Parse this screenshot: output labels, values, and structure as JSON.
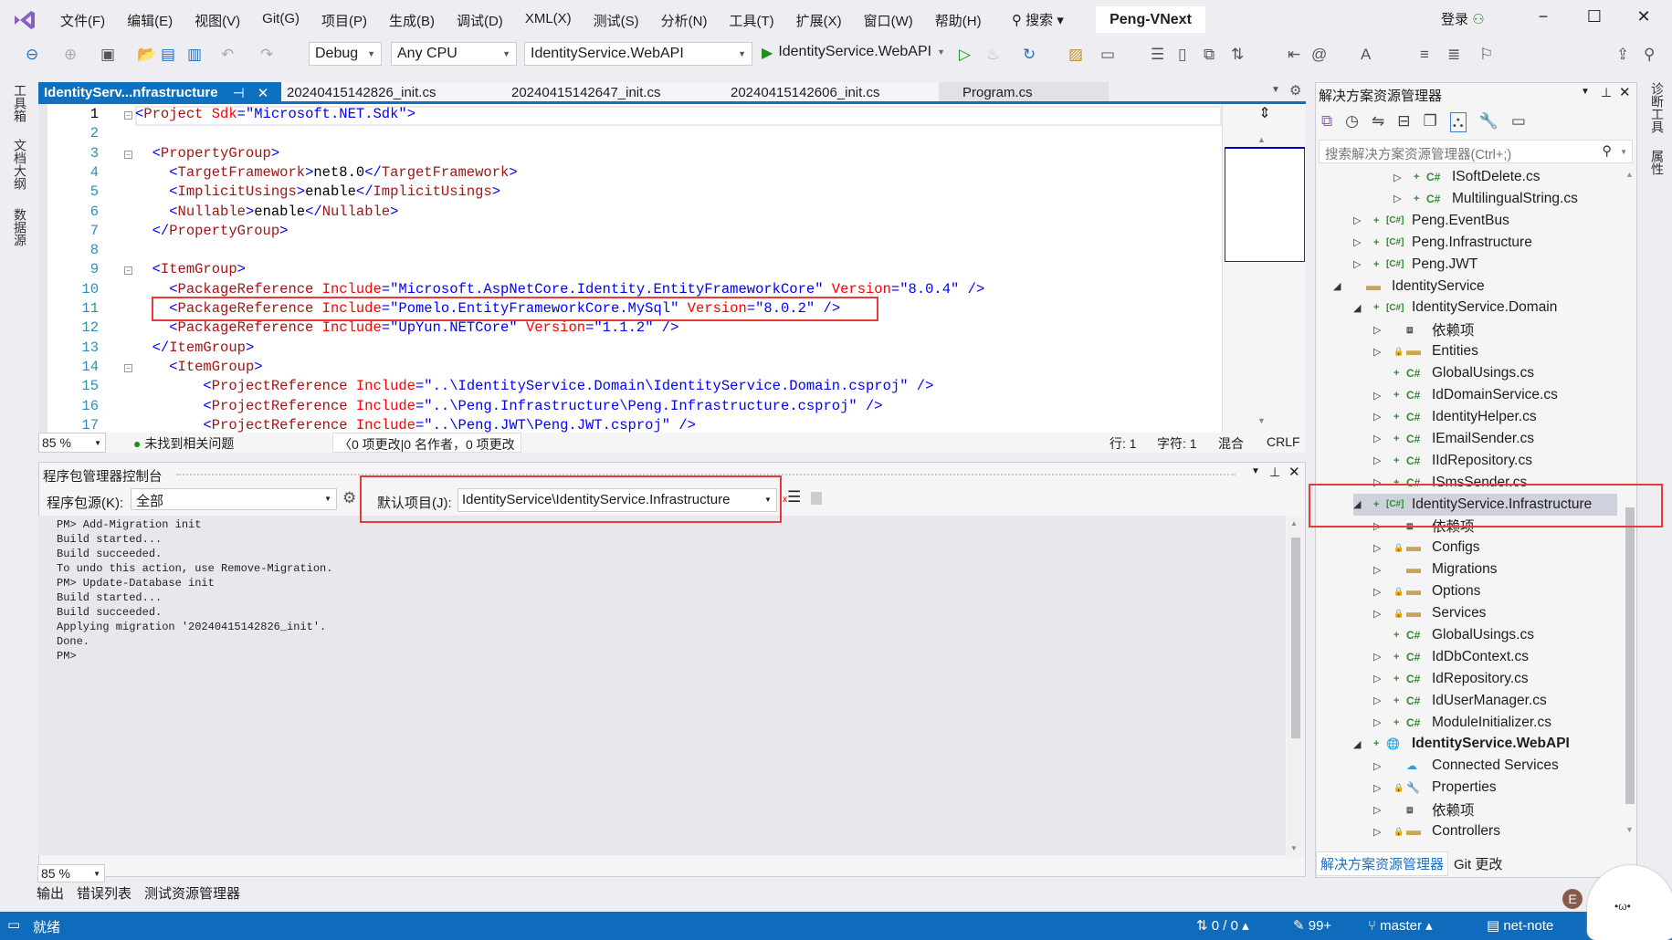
{
  "title_bar": {
    "menus": [
      "文件(F)",
      "编辑(E)",
      "视图(V)",
      "Git(G)",
      "项目(P)",
      "生成(B)",
      "调试(D)",
      "XML(X)",
      "测试(S)",
      "分析(N)",
      "工具(T)",
      "扩展(X)",
      "窗口(W)",
      "帮助(H)"
    ],
    "search": "搜索",
    "solution_name": "Peng-VNext",
    "login": "登录"
  },
  "toolbar": {
    "configuration": "Debug",
    "platform": "Any CPU",
    "startup_project": "IdentityService.WebAPI",
    "run_target": "IdentityService.WebAPI"
  },
  "left_strip": [
    "工具箱",
    "文档大纲",
    "数据源"
  ],
  "right_strip": [
    "诊断工具",
    "属性"
  ],
  "tabs": [
    {
      "label": "IdentityServ...nfrastructure",
      "active": true
    },
    {
      "label": "20240415142826_init.cs"
    },
    {
      "label": "20240415142647_init.cs"
    },
    {
      "label": "20240415142606_init.cs"
    },
    {
      "label": "Program.cs"
    }
  ],
  "editor": {
    "lines": [
      [
        [
          "p",
          "<"
        ],
        [
          "tag",
          "Project"
        ],
        [
          "txt",
          " "
        ],
        [
          "attr",
          "Sdk"
        ],
        [
          "p",
          "=\""
        ],
        [
          "val",
          "Microsoft.NET.Sdk"
        ],
        [
          "p",
          "\">"
        ]
      ],
      [],
      [
        [
          "txt",
          "  "
        ],
        [
          "p",
          "<"
        ],
        [
          "tag",
          "PropertyGroup"
        ],
        [
          "p",
          ">"
        ]
      ],
      [
        [
          "txt",
          "    "
        ],
        [
          "p",
          "<"
        ],
        [
          "tag",
          "TargetFramework"
        ],
        [
          "p",
          ">"
        ],
        [
          "txt",
          "net8.0"
        ],
        [
          "p",
          "</"
        ],
        [
          "tag",
          "TargetFramework"
        ],
        [
          "p",
          ">"
        ]
      ],
      [
        [
          "txt",
          "    "
        ],
        [
          "p",
          "<"
        ],
        [
          "tag",
          "ImplicitUsings"
        ],
        [
          "p",
          ">"
        ],
        [
          "txt",
          "enable"
        ],
        [
          "p",
          "</"
        ],
        [
          "tag",
          "ImplicitUsings"
        ],
        [
          "p",
          ">"
        ]
      ],
      [
        [
          "txt",
          "    "
        ],
        [
          "p",
          "<"
        ],
        [
          "tag",
          "Nullable"
        ],
        [
          "p",
          ">"
        ],
        [
          "txt",
          "enable"
        ],
        [
          "p",
          "</"
        ],
        [
          "tag",
          "Nullable"
        ],
        [
          "p",
          ">"
        ]
      ],
      [
        [
          "txt",
          "  "
        ],
        [
          "p",
          "</"
        ],
        [
          "tag",
          "PropertyGroup"
        ],
        [
          "p",
          ">"
        ]
      ],
      [],
      [
        [
          "txt",
          "  "
        ],
        [
          "p",
          "<"
        ],
        [
          "tag",
          "ItemGroup"
        ],
        [
          "p",
          ">"
        ]
      ],
      [
        [
          "txt",
          "    "
        ],
        [
          "p",
          "<"
        ],
        [
          "tag",
          "PackageReference"
        ],
        [
          "txt",
          " "
        ],
        [
          "attr",
          "Include"
        ],
        [
          "p",
          "=\""
        ],
        [
          "val",
          "Microsoft.AspNetCore.Identity.EntityFrameworkCore"
        ],
        [
          "p",
          "\" "
        ],
        [
          "attr",
          "Version"
        ],
        [
          "p",
          "=\""
        ],
        [
          "val",
          "8.0.4"
        ],
        [
          "p",
          "\" />"
        ]
      ],
      [
        [
          "txt",
          "    "
        ],
        [
          "p",
          "<"
        ],
        [
          "tag",
          "PackageReference"
        ],
        [
          "txt",
          " "
        ],
        [
          "attr",
          "Include"
        ],
        [
          "p",
          "=\""
        ],
        [
          "val",
          "Pomelo.EntityFrameworkCore.MySql"
        ],
        [
          "p",
          "\" "
        ],
        [
          "attr",
          "Version"
        ],
        [
          "p",
          "=\""
        ],
        [
          "val",
          "8.0.2"
        ],
        [
          "p",
          "\" />"
        ]
      ],
      [
        [
          "txt",
          "    "
        ],
        [
          "p",
          "<"
        ],
        [
          "tag",
          "PackageReference"
        ],
        [
          "txt",
          " "
        ],
        [
          "attr",
          "Include"
        ],
        [
          "p",
          "=\""
        ],
        [
          "val",
          "UpYun.NETCore"
        ],
        [
          "p",
          "\" "
        ],
        [
          "attr",
          "Version"
        ],
        [
          "p",
          "=\""
        ],
        [
          "val",
          "1.1.2"
        ],
        [
          "p",
          "\" />"
        ]
      ],
      [
        [
          "txt",
          "  "
        ],
        [
          "p",
          "</"
        ],
        [
          "tag",
          "ItemGroup"
        ],
        [
          "p",
          ">"
        ]
      ],
      [
        [
          "txt",
          "    "
        ],
        [
          "p",
          "<"
        ],
        [
          "tag",
          "ItemGroup"
        ],
        [
          "p",
          ">"
        ]
      ],
      [
        [
          "txt",
          "        "
        ],
        [
          "p",
          "<"
        ],
        [
          "tag",
          "ProjectReference"
        ],
        [
          "txt",
          " "
        ],
        [
          "attr",
          "Include"
        ],
        [
          "p",
          "=\""
        ],
        [
          "val",
          "..\\IdentityService.Domain\\IdentityService.Domain.csproj"
        ],
        [
          "p",
          "\" />"
        ]
      ],
      [
        [
          "txt",
          "        "
        ],
        [
          "p",
          "<"
        ],
        [
          "tag",
          "ProjectReference"
        ],
        [
          "txt",
          " "
        ],
        [
          "attr",
          "Include"
        ],
        [
          "p",
          "=\""
        ],
        [
          "val",
          "..\\Peng.Infrastructure\\Peng.Infrastructure.csproj"
        ],
        [
          "p",
          "\" />"
        ]
      ],
      [
        [
          "txt",
          "        "
        ],
        [
          "p",
          "<"
        ],
        [
          "tag",
          "ProjectReference"
        ],
        [
          "txt",
          " "
        ],
        [
          "attr",
          "Include"
        ],
        [
          "p",
          "=\""
        ],
        [
          "val",
          "..\\Peng.JWT\\Peng.JWT.csproj"
        ],
        [
          "p",
          "\" />"
        ]
      ]
    ],
    "zoom": "85 %",
    "issues": "未找到相关问题",
    "changes": "0 项更改|0 名作者，0 项更改",
    "row": "行: 1",
    "col": "字符: 1",
    "whitespace": "混合",
    "eol": "CRLF"
  },
  "pmc": {
    "title": "程序包管理器控制台",
    "source_label": "程序包源(K):",
    "source_value": "全部",
    "default_project_label": "默认项目(J):",
    "default_project_value": "IdentityService\\IdentityService.Infrastructure",
    "output": [
      "PM> Add-Migration init",
      "Build started...",
      "Build succeeded.",
      "To undo this action, use Remove-Migration.",
      "PM> Update-Database init",
      "Build started...",
      "Build succeeded.",
      "Applying migration '20240415142826_init'.",
      "Done.",
      "PM>"
    ],
    "zoom": "85 %"
  },
  "bottom_tabs": [
    "输出",
    "错误列表",
    "测试资源管理器"
  ],
  "solution_explorer": {
    "title": "解决方案资源管理器",
    "search_placeholder": "搜索解决方案资源管理器(Ctrl+;)",
    "items": [
      {
        "label": "ISoftDelete.cs",
        "level": 3,
        "exp": "closed",
        "ov": "plus",
        "icon": "cs"
      },
      {
        "label": "MultilingualString.cs",
        "level": 3,
        "exp": "closed",
        "ov": "plus",
        "icon": "cs"
      },
      {
        "label": "Peng.EventBus",
        "level": 1,
        "exp": "closed",
        "ov": "plus",
        "icon": "csproj"
      },
      {
        "label": "Peng.Infrastructure",
        "level": 1,
        "exp": "closed",
        "ov": "plus",
        "icon": "csproj"
      },
      {
        "label": "Peng.JWT",
        "level": 1,
        "exp": "closed",
        "ov": "plus",
        "icon": "csproj"
      },
      {
        "label": "IdentityService",
        "level": 0,
        "exp": "open",
        "ov": "",
        "icon": "folder"
      },
      {
        "label": "IdentityService.Domain",
        "level": 1,
        "exp": "open",
        "ov": "plus",
        "icon": "csproj"
      },
      {
        "label": "依赖项",
        "level": 2,
        "exp": "closed",
        "ov": "",
        "icon": "deps"
      },
      {
        "label": "Entities",
        "level": 2,
        "exp": "closed",
        "ov": "lock",
        "icon": "folder"
      },
      {
        "label": "GlobalUsings.cs",
        "level": 2,
        "exp": "",
        "ov": "plus",
        "icon": "cs"
      },
      {
        "label": "IdDomainService.cs",
        "level": 2,
        "exp": "closed",
        "ov": "plus",
        "icon": "cs"
      },
      {
        "label": "IdentityHelper.cs",
        "level": 2,
        "exp": "closed",
        "ov": "plus",
        "icon": "cs"
      },
      {
        "label": "IEmailSender.cs",
        "level": 2,
        "exp": "closed",
        "ov": "plus",
        "icon": "cs"
      },
      {
        "label": "IIdRepository.cs",
        "level": 2,
        "exp": "closed",
        "ov": "plus",
        "icon": "cs"
      },
      {
        "label": "ISmsSender.cs",
        "level": 2,
        "exp": "closed",
        "ov": "plus",
        "icon": "cs"
      },
      {
        "label": "IdentityService.Infrastructure",
        "level": 1,
        "exp": "open",
        "ov": "plus",
        "icon": "csproj",
        "selected": true
      },
      {
        "label": "依赖项",
        "level": 2,
        "exp": "closed",
        "ov": "",
        "icon": "deps"
      },
      {
        "label": "Configs",
        "level": 2,
        "exp": "closed",
        "ov": "lock",
        "icon": "folder"
      },
      {
        "label": "Migrations",
        "level": 2,
        "exp": "closed",
        "ov": "",
        "icon": "folder"
      },
      {
        "label": "Options",
        "level": 2,
        "exp": "closed",
        "ov": "lock",
        "icon": "folder"
      },
      {
        "label": "Services",
        "level": 2,
        "exp": "closed",
        "ov": "lock",
        "icon": "folder"
      },
      {
        "label": "GlobalUsings.cs",
        "level": 2,
        "exp": "",
        "ov": "plus",
        "icon": "cs"
      },
      {
        "label": "IdDbContext.cs",
        "level": 2,
        "exp": "closed",
        "ov": "plus",
        "icon": "cs"
      },
      {
        "label": "IdRepository.cs",
        "level": 2,
        "exp": "closed",
        "ov": "plus",
        "icon": "cs"
      },
      {
        "label": "IdUserManager.cs",
        "level": 2,
        "exp": "closed",
        "ov": "plus",
        "icon": "cs"
      },
      {
        "label": "ModuleInitializer.cs",
        "level": 2,
        "exp": "closed",
        "ov": "plus",
        "icon": "cs"
      },
      {
        "label": "IdentityService.WebAPI",
        "level": 1,
        "exp": "open",
        "ov": "plus",
        "icon": "web",
        "bold": true
      },
      {
        "label": "Connected Services",
        "level": 2,
        "exp": "closed",
        "ov": "",
        "icon": "cloud"
      },
      {
        "label": "Properties",
        "level": 2,
        "exp": "closed",
        "ov": "lock",
        "icon": "props"
      },
      {
        "label": "依赖项",
        "level": 2,
        "exp": "closed",
        "ov": "",
        "icon": "deps"
      },
      {
        "label": "Controllers",
        "level": 2,
        "exp": "closed",
        "ov": "lock",
        "icon": "folder"
      }
    ],
    "bottom_tabs": [
      "解决方案资源管理器",
      "Git 更改"
    ]
  },
  "status_bar": {
    "ready": "就绪",
    "sync": "0 / 0",
    "edits": "99+",
    "branch": "master",
    "repo": "net-note"
  },
  "colors": {
    "accent": "#0f6cbd",
    "highlight_box": "#e8393b",
    "tag": "#a31515",
    "attr": "#ff0000",
    "value": "#0000ff"
  }
}
